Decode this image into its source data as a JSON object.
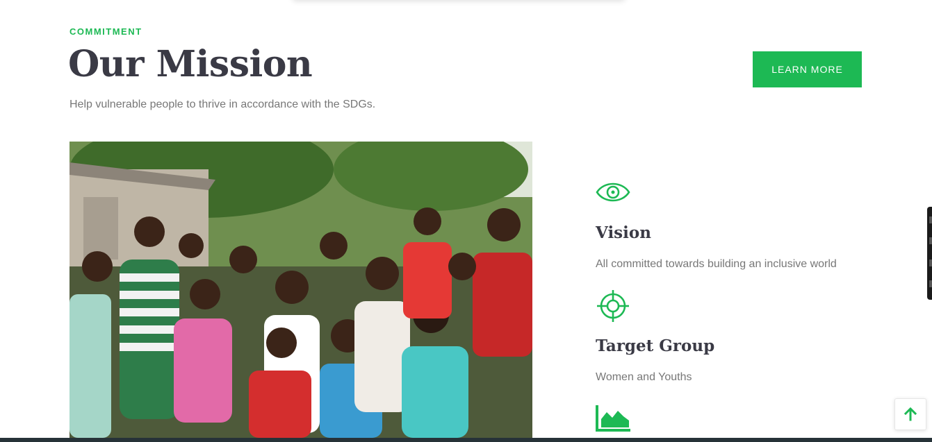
{
  "section": {
    "eyebrow": "COMMITMENT",
    "title": "Our Mission",
    "subtitle": "Help vulnerable people to thrive in accordance with the SDGs.",
    "learn_more": "LEARN MORE"
  },
  "features": [
    {
      "icon": "eye-icon",
      "title": "Vision",
      "text": "All committed towards building an inclusive world"
    },
    {
      "icon": "target-icon",
      "title": "Target Group",
      "text": "Women and Youths"
    },
    {
      "icon": "area-chart-icon"
    }
  ],
  "colors": {
    "accent": "#1db954",
    "heading": "#3a3a45",
    "body_text": "#777777",
    "footer_bar": "#263238"
  },
  "images": {
    "mission_photo": "group of children standing outdoors"
  },
  "controls": {
    "scroll_top_icon": "arrow-up-icon"
  }
}
